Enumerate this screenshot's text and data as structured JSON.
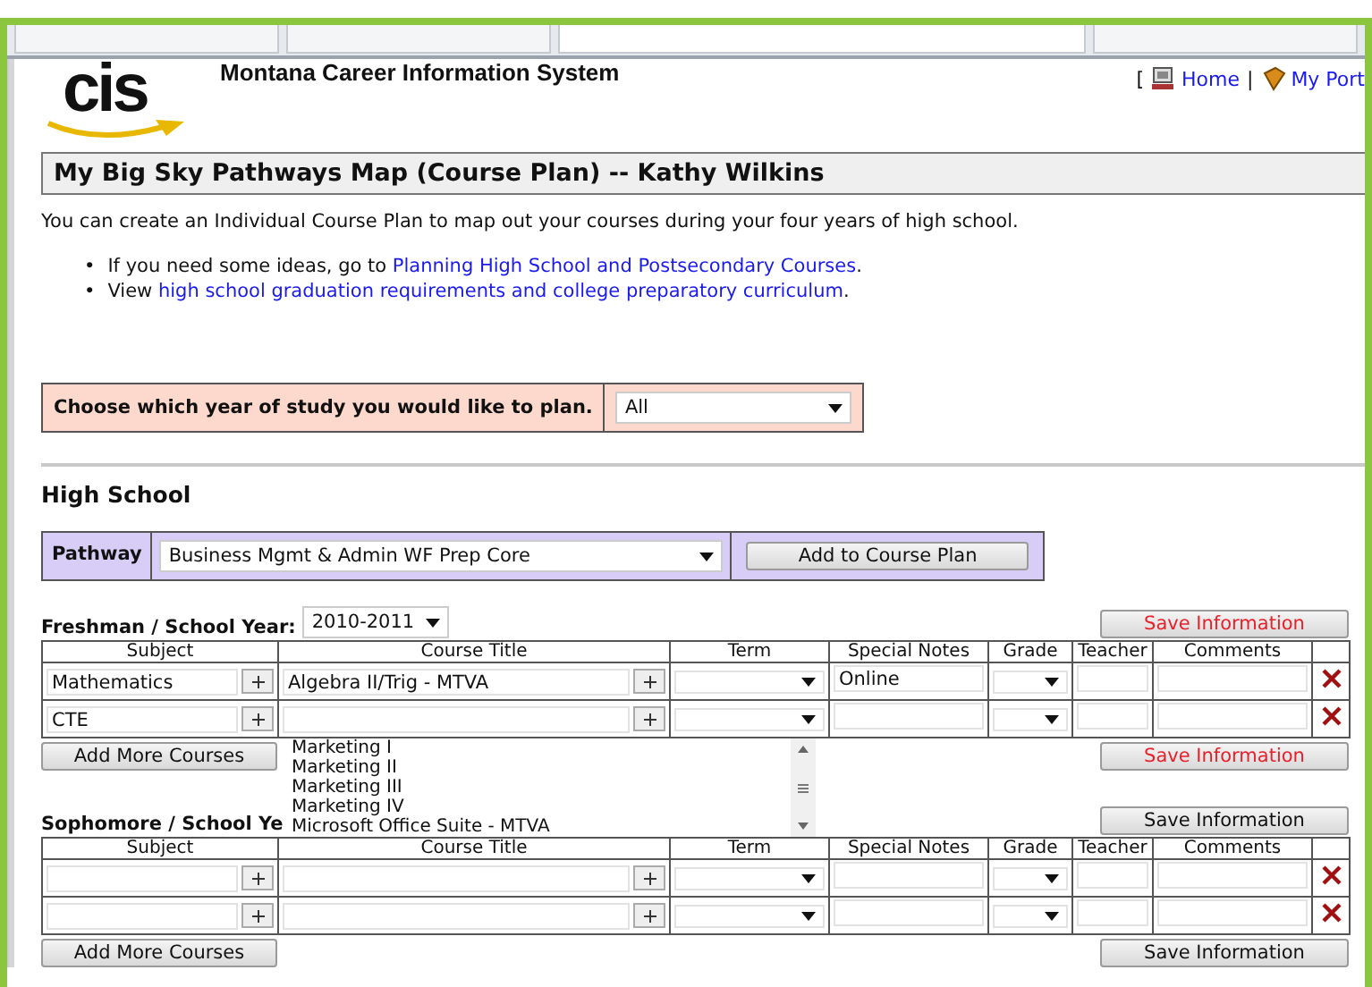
{
  "header": {
    "logo": "cis",
    "site_title": "Montana Career Information System",
    "nav": [
      {
        "kind": "text",
        "text": "["
      },
      {
        "kind": "link",
        "text": "Home"
      },
      {
        "kind": "text",
        "text": "|"
      },
      {
        "kind": "link",
        "text": "My Port"
      }
    ]
  },
  "page_title": "My Big Sky Pathways Map (Course Plan) -- Kathy Wilkins",
  "intro": "You can create an Individual Course Plan to map out your courses during your four years of high school.",
  "bullets": [
    {
      "marker": "•",
      "text": "If you need some ideas, go to ",
      "link": "Planning High School and Postsecondary Courses",
      "after": "."
    },
    {
      "marker": "•",
      "text": "View ",
      "link": "high school graduation requirements and college preparatory curriculum",
      "after": "."
    }
  ],
  "year_chooser": {
    "label": "Choose which year of study you would like to plan.",
    "value": "All"
  },
  "section_heading": "High School",
  "pathway": {
    "label": "Pathway",
    "value": "Business Mgmt & Admin WF Prep Core",
    "button": "Add to Course Plan"
  },
  "years": [
    {
      "title": "Freshman / School Year:",
      "year_value": "2010-2011",
      "save_top": {
        "label": "Save Information",
        "unsaved": true
      },
      "columns": [
        "Subject",
        "Course Title",
        "Term",
        "Special Notes",
        "Grade",
        "Teacher",
        "Comments"
      ],
      "rows": [
        {
          "subject": "Mathematics",
          "course": "Algebra II/Trig - MTVA",
          "notes": "Online"
        },
        {
          "subject": "CTE",
          "course": "",
          "notes": ""
        }
      ],
      "add_button": "Add More Courses",
      "save_bottom": {
        "label": "Save Information",
        "unsaved": true
      },
      "dropdown": [
        "Marketing I",
        "Marketing II",
        "Marketing III",
        "Marketing IV",
        "Microsoft Office Suite - MTVA"
      ]
    },
    {
      "title": "Sophomore / School Ye",
      "save_top": {
        "label": "Save Information",
        "unsaved": false
      },
      "columns": [
        "Subject",
        "Course Title",
        "Term",
        "Special Notes",
        "Grade",
        "Teacher",
        "Comments"
      ],
      "rows": [
        {
          "subject": "",
          "course": "",
          "notes": ""
        },
        {
          "subject": "",
          "course": "",
          "notes": ""
        }
      ],
      "add_button": "Add More Courses",
      "save_bottom": {
        "label": "Save Information",
        "unsaved": false
      }
    }
  ]
}
